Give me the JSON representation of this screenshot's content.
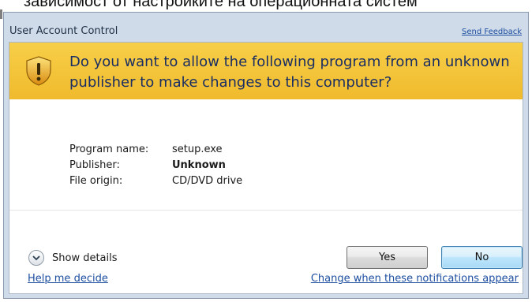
{
  "doc_caption": "зависимост от настройките на операционната систем",
  "dialog": {
    "title": "User Account Control",
    "send_feedback": "Send Feedback",
    "question": "Do you want to allow the following program from an unknown publisher to make changes to this computer?",
    "details": [
      {
        "label": "Program name:",
        "value": "setup.exe"
      },
      {
        "label": "Publisher:",
        "value": "Unknown"
      },
      {
        "label": "File origin:",
        "value": "CD/DVD drive"
      }
    ],
    "show_details": "Show details",
    "yes_label": "Yes",
    "no_label": "No",
    "help_link": "Help me decide",
    "change_link": "Change when these notifications appear"
  },
  "icons": {
    "shield": "shield-warning-icon",
    "chevron": "chevron-down-icon"
  },
  "colors": {
    "banner": "#f5c53a",
    "title_text": "#1b2e63",
    "link": "#1d4ea0",
    "frame": "#cfdbe9"
  }
}
